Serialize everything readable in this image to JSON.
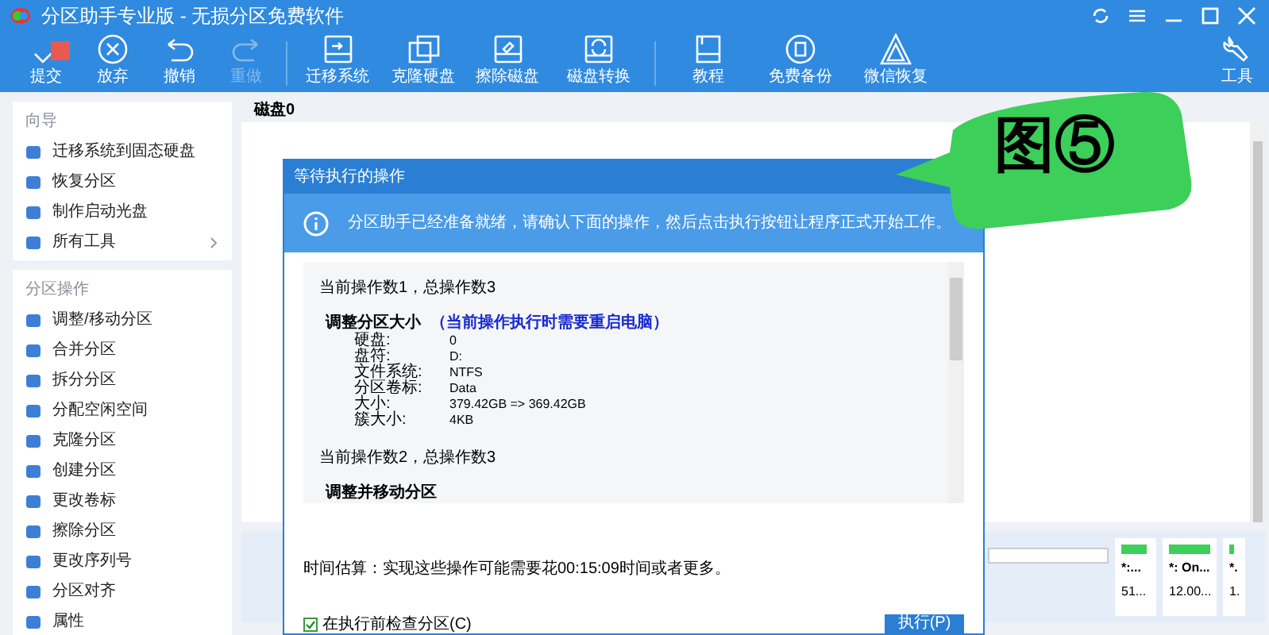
{
  "window": {
    "title": "分区助手专业版 - 无损分区免费软件"
  },
  "toolbar": [
    {
      "label": "提交",
      "disabled": false
    },
    {
      "label": "放弃",
      "disabled": false
    },
    {
      "label": "撤销",
      "disabled": false
    },
    {
      "label": "重做",
      "disabled": true
    },
    {
      "label": "迁移系统",
      "disabled": false
    },
    {
      "label": "克隆硬盘",
      "disabled": false
    },
    {
      "label": "擦除磁盘",
      "disabled": false
    },
    {
      "label": "磁盘转换",
      "disabled": false
    },
    {
      "label": "教程",
      "disabled": false
    },
    {
      "label": "免费备份",
      "disabled": false
    },
    {
      "label": "微信恢复",
      "disabled": false
    }
  ],
  "tools_button": {
    "label": "工具"
  },
  "sidebar": [
    {
      "heading": "向导",
      "items": [
        {
          "label": "迁移系统到固态硬盘",
          "has_submenu": false
        },
        {
          "label": "恢复分区",
          "has_submenu": false
        },
        {
          "label": "制作启动光盘",
          "has_submenu": false
        },
        {
          "label": "所有工具",
          "has_submenu": true
        }
      ]
    },
    {
      "heading": "分区操作",
      "items": [
        {
          "label": "调整/移动分区",
          "has_submenu": false
        },
        {
          "label": "合并分区",
          "has_submenu": false
        },
        {
          "label": "拆分分区",
          "has_submenu": false
        },
        {
          "label": "分配空闲空间",
          "has_submenu": false
        },
        {
          "label": "克隆分区",
          "has_submenu": false
        },
        {
          "label": "创建分区",
          "has_submenu": false
        },
        {
          "label": "更改卷标",
          "has_submenu": false
        },
        {
          "label": "擦除分区",
          "has_submenu": false
        },
        {
          "label": "更改序列号",
          "has_submenu": false
        },
        {
          "label": "分区对齐",
          "has_submenu": false
        },
        {
          "label": "属性",
          "has_submenu": false
        }
      ]
    }
  ],
  "main": {
    "disk_header": "磁盘0",
    "disk_cards": [
      {
        "name": "*:...",
        "size": "51..."
      },
      {
        "name": "*: On...",
        "size": "12.00..."
      },
      {
        "name": "*.",
        "size": "1."
      }
    ]
  },
  "dialog": {
    "title": "等待执行的操作",
    "info": "分区助手已经准备就绪，请确认下面的操作，然后点击执行按钮让程序正式开始工作。",
    "operations": [
      {
        "kind": "count",
        "text": "当前操作数1，总操作数3"
      },
      {
        "kind": "title",
        "text": "调整分区大小",
        "note": "（当前操作执行时需要重启电脑）"
      },
      {
        "kind": "field",
        "key": "硬盘:",
        "value": "0"
      },
      {
        "kind": "field",
        "key": "盘符:",
        "value": "D:"
      },
      {
        "kind": "field",
        "key": "文件系统:",
        "value": "NTFS"
      },
      {
        "kind": "field",
        "key": "分区卷标:",
        "value": "Data"
      },
      {
        "kind": "field",
        "key": "大小:",
        "value": "379.42GB => 369.42GB"
      },
      {
        "kind": "field",
        "key": "簇大小:",
        "value": "4KB"
      },
      {
        "kind": "count",
        "text": "当前操作数2，总操作数3"
      },
      {
        "kind": "title",
        "text": "调整并移动分区"
      }
    ],
    "estimate": "时间估算：实现这些操作可能需要花00:15:09时间或者更多。",
    "check": {
      "label": "在执行前检查分区(C)",
      "checked": true
    },
    "execute_button": "执行(P)"
  },
  "callout": {
    "text": "图⑤"
  }
}
